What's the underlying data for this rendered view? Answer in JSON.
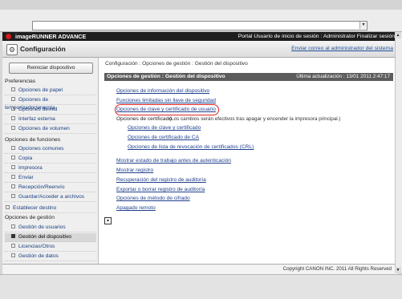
{
  "browser": {
    "address": "",
    "dropdown_glyph": "▾"
  },
  "header": {
    "brand": "imageRUNNER ADVANCE",
    "portal_text": "Portal  Usuario de inicio de sesión : Administrator Finalizar sesión",
    "title": "Configuración",
    "mail_link": "Enviar correo al administrador del sistema"
  },
  "sidebar": {
    "restart_button": "Reiniciar dispositivo",
    "sections": [
      {
        "title": "Preferencias",
        "items": [
          "Opciones de papel",
          "Opciones de temporizador/energía",
          "Opciones de red",
          "Interfaz externa",
          "Opciones de volumen"
        ]
      },
      {
        "title": "Opciones de funciones",
        "items": [
          "Opciones comunes",
          "Copia",
          "Impresora",
          "Enviar",
          "Recepción/Reenvío",
          "Guardar/Acceder a archivos"
        ]
      },
      {
        "title": "Establecer destino",
        "items": []
      },
      {
        "title": "Opciones de gestión",
        "items": [
          "Gestión de usuarios",
          "Gestión del dispositivo",
          "Licencias/Otros",
          "Gestión de datos"
        ]
      }
    ],
    "active_item": "Gestión del dispositivo"
  },
  "main": {
    "breadcrumb": "Configuración : Opciones de gestión : Gestión del dispositivo",
    "section_title": "Opciones de gestión : Gestión del dispositivo",
    "last_update": "Última actualización : 13/01 2011 2:47:17",
    "links1": [
      "Opciones de información del dispositivo",
      "Funciones limitadas sin llave de seguridad",
      "Opciones de clave y certificado de usuario"
    ],
    "cert_label": "Opciones de certificado",
    "cert_note": "(Los cambios serán efectivos tras apagar y encender la impresora principal.)",
    "cert_sublinks": [
      "Opciones de clave y certificado",
      "Opciones de certificado de CA",
      "Opciones de lista de revocación de certificados (CRL)"
    ],
    "links2": [
      "Mostrar estado de trabajo antes de autenticación",
      "Mostrar registro",
      "Recuperación del registro de auditoría",
      "Exportar o borrar registro de auditoría",
      "Opciones de método de cifrado",
      "Apagado remoto"
    ],
    "top_glyph": "▲"
  },
  "footer": {
    "copyright": "Copyright CANON INC. 2011 All Rights Reserved"
  },
  "colors": {
    "highlight": "#e02020",
    "link": "#1f3f8c",
    "header_bar": "#1e1e1e",
    "section_header": "#5c5c5c"
  }
}
